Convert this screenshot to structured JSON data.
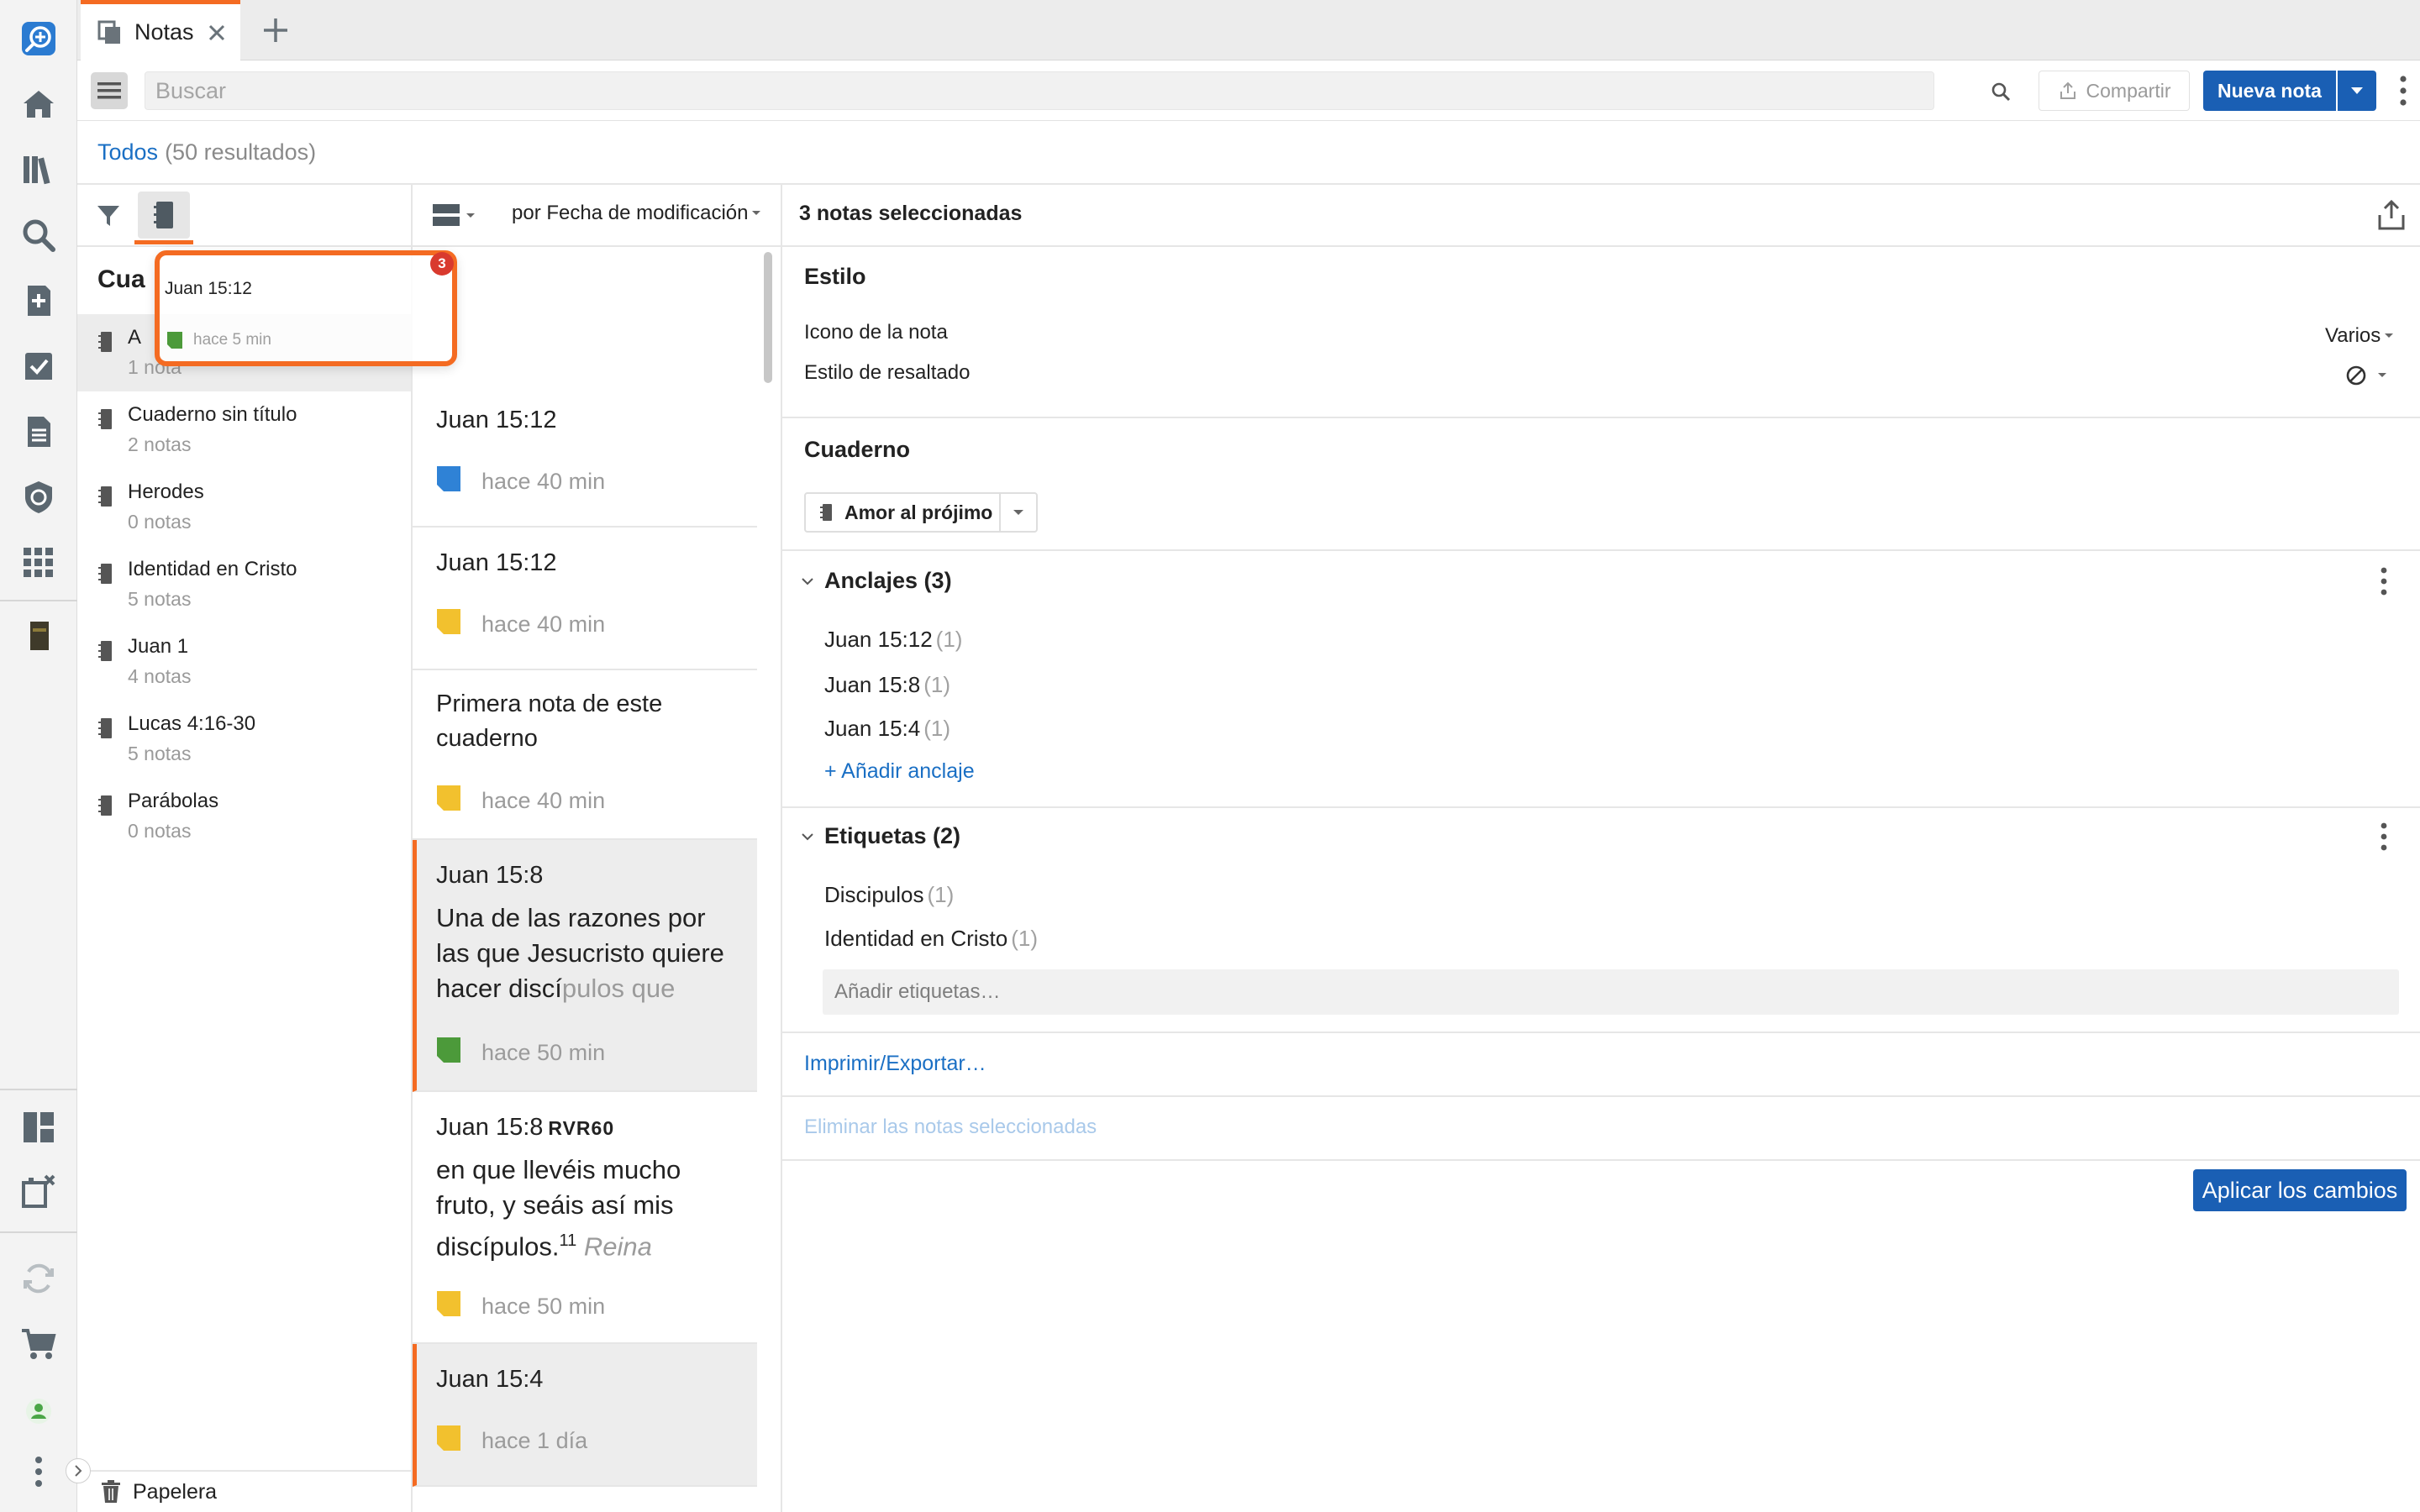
{
  "tab": {
    "label": "Notas"
  },
  "toolbar": {
    "search_placeholder": "Buscar",
    "share_label": "Compartir",
    "new_note_label": "Nueva nota"
  },
  "breadcrumb": {
    "label": "Todos",
    "count": "(50 resultados)"
  },
  "sidebar": {
    "heading": "Cua",
    "notebooks": [
      {
        "title": "A",
        "count": "1 nota"
      },
      {
        "title": "Cuaderno sin título",
        "count": "2 notas"
      },
      {
        "title": "Herodes",
        "count": "0 notas"
      },
      {
        "title": "Identidad en Cristo",
        "count": "5 notas"
      },
      {
        "title": "Juan 1",
        "count": "4 notas"
      },
      {
        "title": "Lucas 4:16-30",
        "count": "5 notas"
      },
      {
        "title": "Parábolas",
        "count": "0 notas"
      }
    ],
    "trash_label": "Papelera"
  },
  "drag_ghost": {
    "title": "Juan 15:12",
    "time": "hace 5 min",
    "badge": "3"
  },
  "note_list": {
    "sort_label": "por Fecha de modificación",
    "notes": [
      {
        "title": "Juan 15:12",
        "time": "hace 40 min",
        "color": "#2f82d6"
      },
      {
        "title": "Juan 15:12",
        "time": "hace 40 min",
        "color": "#f2c12e"
      },
      {
        "title": "Primera nota de este cuaderno",
        "time": "hace 40 min",
        "color": "#f2c12e"
      },
      {
        "title": "Juan 15:8",
        "body_main": "Una de las razones por las que Jesucristo quiere hacer discí",
        "body_fade": "pulos que",
        "time": "hace 50 min",
        "color": "#4c9a3a"
      },
      {
        "title": "Juan 15:8",
        "version": "RVR60",
        "body_main": "en que llevéis mucho fruto, y seáis así mis discípulos.",
        "footnote": "11",
        "body_fade": "Reina",
        "time": "hace 50 min",
        "color": "#f2c12e"
      },
      {
        "title": "Juan 15:4",
        "time": "hace 1 día",
        "color": "#f2c12e"
      }
    ]
  },
  "detail": {
    "selected_title": "3 notas seleccionadas",
    "style_section": "Estilo",
    "note_icon_label": "Icono de la nota",
    "note_icon_value": "Varios",
    "highlight_label": "Estilo de resaltado",
    "notebook_section": "Cuaderno",
    "notebook_value": "Amor al prójimo",
    "anchors_title": "Anclajes (3)",
    "anchors": [
      {
        "ref": "Juan 15:12",
        "count": "(1)"
      },
      {
        "ref": "Juan 15:8",
        "count": "(1)"
      },
      {
        "ref": "Juan 15:4",
        "count": "(1)"
      }
    ],
    "add_anchor": "+ Añadir anclaje",
    "tags_title": "Etiquetas (2)",
    "tags": [
      {
        "name": "Discipulos",
        "count": "(1)"
      },
      {
        "name": "Identidad en Cristo",
        "count": "(1)"
      }
    ],
    "tag_placeholder": "Añadir etiquetas…",
    "print_label": "Imprimir/Exportar…",
    "delete_label": "Eliminar las notas seleccionadas",
    "apply_label": "Aplicar los cambios"
  },
  "colors": {
    "accent": "#f46b22",
    "primary": "#1a5fb4",
    "link": "#1a6fc4"
  }
}
